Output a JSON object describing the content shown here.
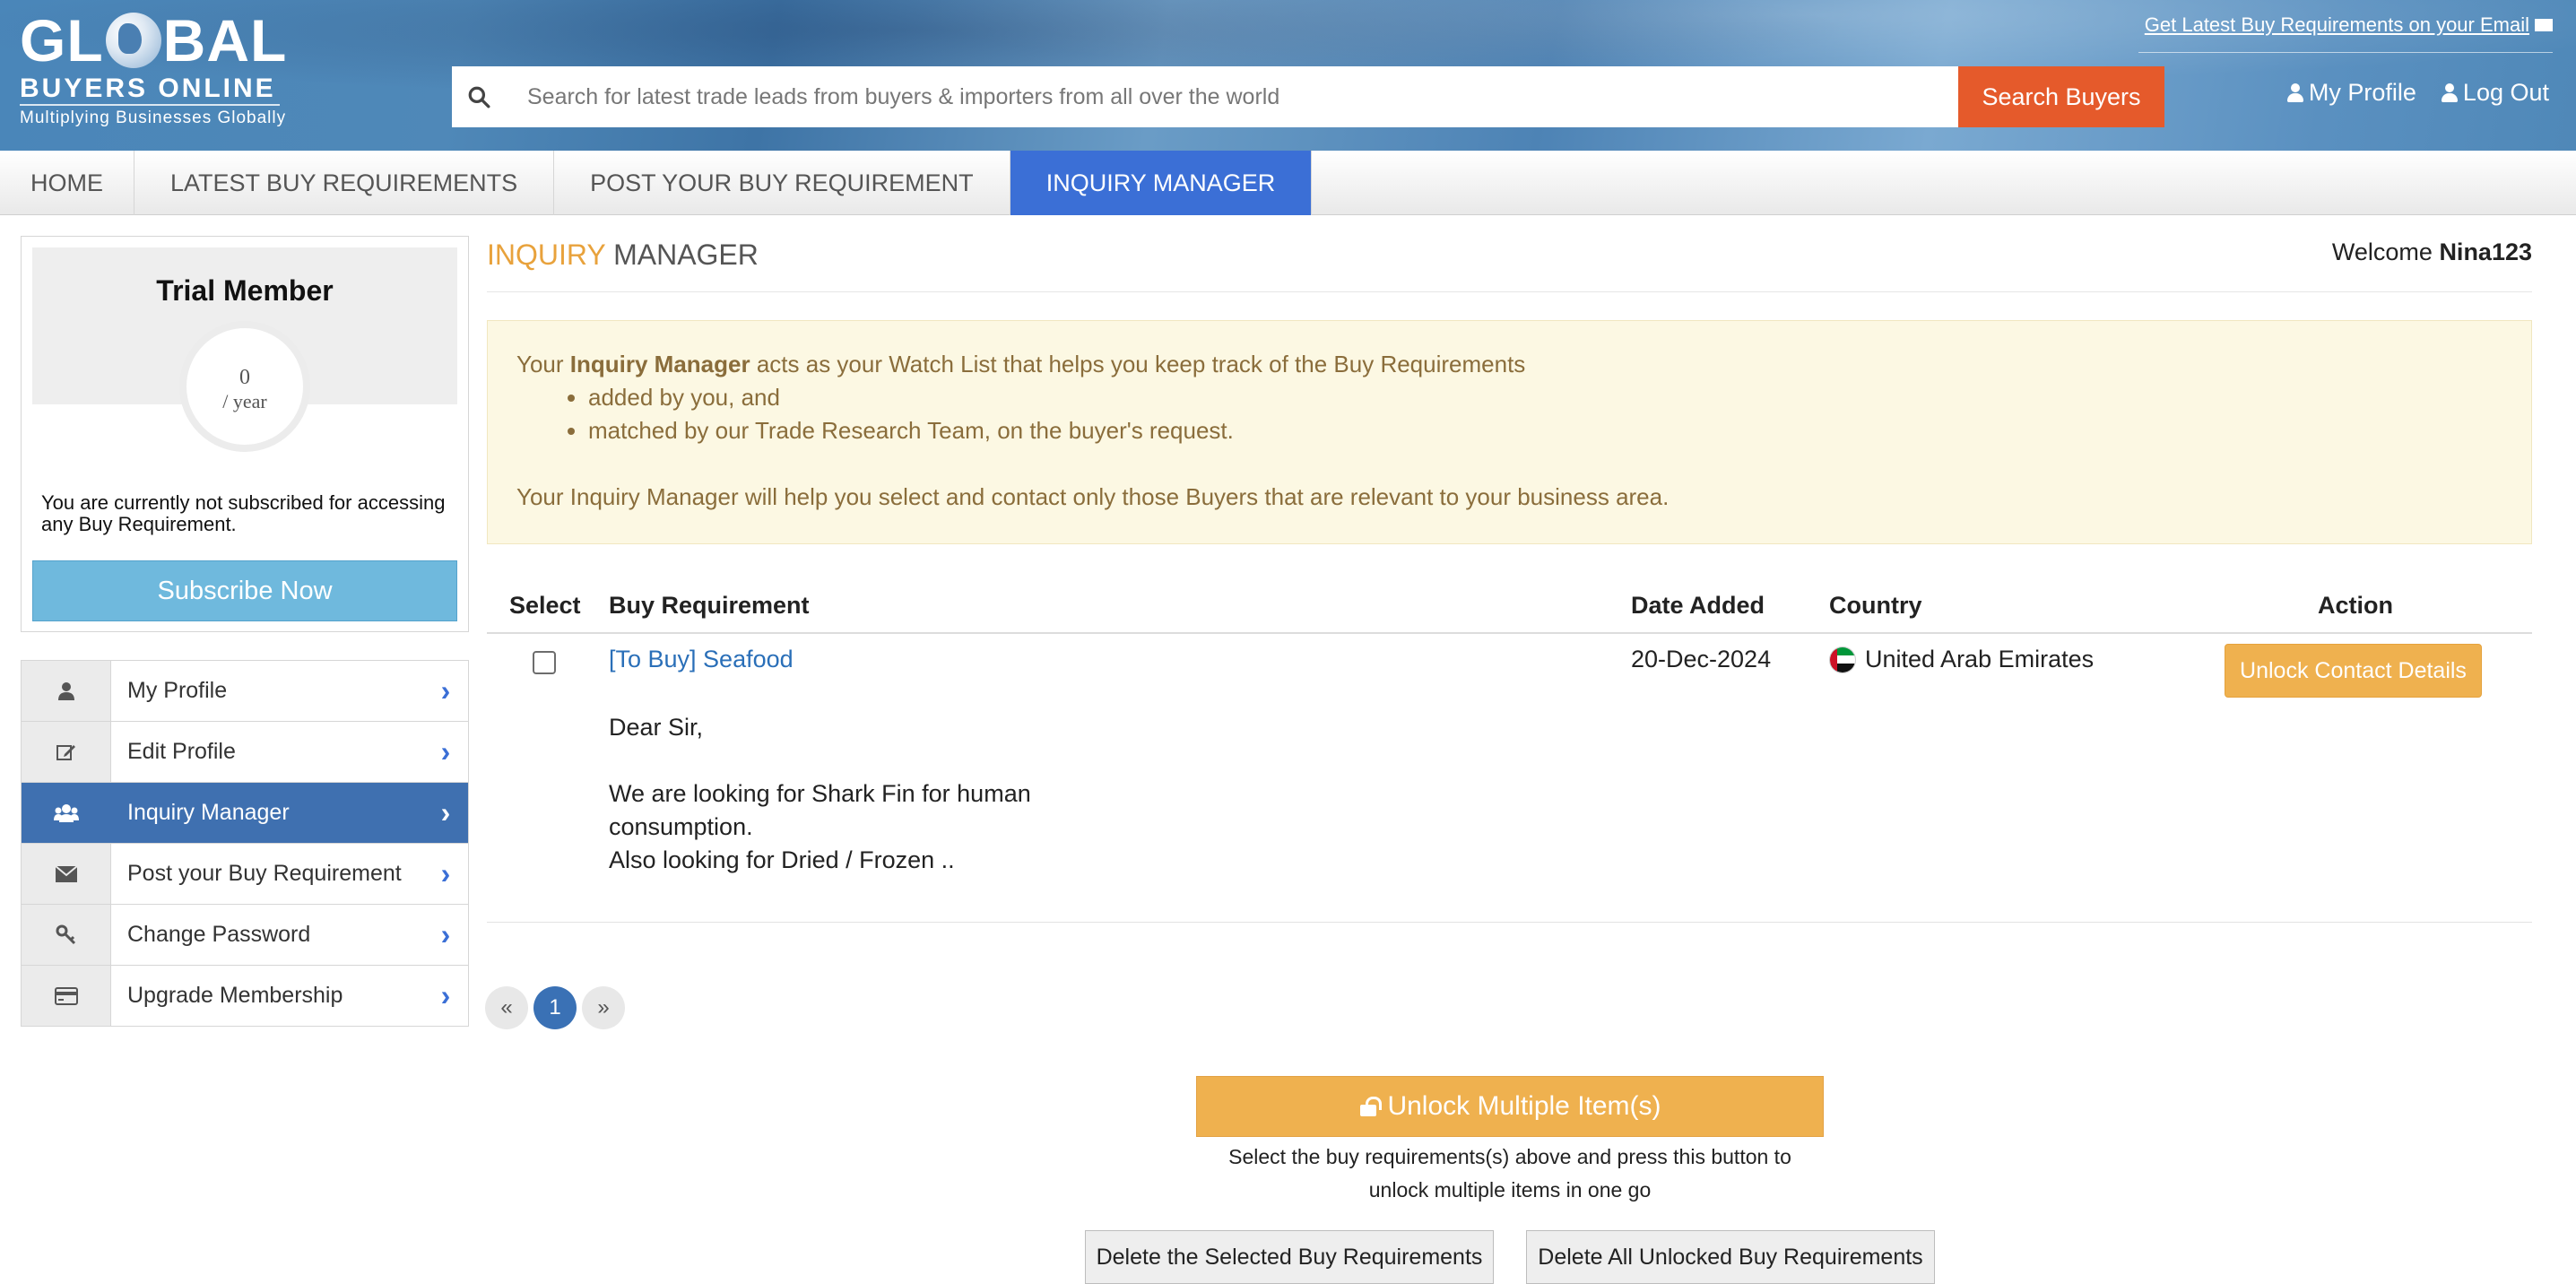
{
  "header": {
    "logo_big_pre": "GL",
    "logo_big_post": "BAL",
    "logo_mid": "BUYERS ONLINE",
    "logo_tagline": "Multiplying Businesses Globally",
    "email_link": "Get Latest Buy Requirements on your Email",
    "search_placeholder": "Search for latest trade leads from buyers & importers from all over the world",
    "search_button": "Search Buyers",
    "my_profile": "My Profile",
    "log_out": "Log Out"
  },
  "nav": {
    "items": [
      {
        "label": "HOME"
      },
      {
        "label": "LATEST BUY REQUIREMENTS"
      },
      {
        "label": "POST YOUR BUY REQUIREMENT"
      },
      {
        "label": "INQUIRY MANAGER"
      }
    ],
    "active": "INQUIRY MANAGER"
  },
  "sidebar": {
    "plan_title": "Trial Member",
    "price_value": "0",
    "price_unit": "/ year",
    "message": "You are currently not subscribed for accessing any Buy Requirement.",
    "subscribe_button": "Subscribe Now",
    "menu": [
      {
        "label": "My Profile",
        "icon": "user-icon"
      },
      {
        "label": "Edit Profile",
        "icon": "edit-icon"
      },
      {
        "label": "Inquiry Manager",
        "icon": "users-icon"
      },
      {
        "label": "Post your Buy Requirement",
        "icon": "envelope-icon"
      },
      {
        "label": "Change Password",
        "icon": "key-icon"
      },
      {
        "label": "Upgrade Membership",
        "icon": "credit-card-icon"
      }
    ],
    "active_item": "Inquiry Manager"
  },
  "main": {
    "title_highlight": "INQUIRY",
    "title_rest": "MANAGER",
    "welcome_prefix": "Welcome",
    "username": "Nina123",
    "notice": {
      "line1_prefix": "Your",
      "line1_bold": "Inquiry Manager",
      "line1_suffix": "acts as your Watch List that helps you keep track of the Buy Requirements",
      "bullets": [
        "added by you, and",
        "matched by our Trade Research Team, on the buyer's request."
      ],
      "line2": "Your Inquiry Manager will help you select and contact only those Buyers that are relevant to your business area."
    },
    "table": {
      "headers": [
        "Select",
        "Buy Requirement",
        "Date Added",
        "Country",
        "Action"
      ],
      "rows": [
        {
          "title": "[To Buy] Seafood",
          "greeting": "Dear Sir,",
          "body_line1": "We are looking for Shark Fin for human consumption.",
          "body_line2": "Also looking for Dried / Frozen ..",
          "date": "20-Dec-2024",
          "country": "United Arab Emirates",
          "action": "Unlock Contact Details"
        }
      ]
    },
    "pagination": {
      "prev": "«",
      "current": "1",
      "next": "»"
    },
    "unlock_multiple": "Unlock Multiple Item(s)",
    "unlock_help": "Select the buy requirements(s) above and press this button to unlock multiple items in one go",
    "delete_selected": "Delete the Selected Buy Requirements",
    "delete_unlocked": "Delete All Unlocked Buy Requirements"
  },
  "colors": {
    "accent_orange": "#e55a2b",
    "nav_active": "#3b6fd6",
    "highlight": "#e8a23c",
    "unlock_button": "#efb14f",
    "subscribe_button": "#6fb9dd"
  }
}
